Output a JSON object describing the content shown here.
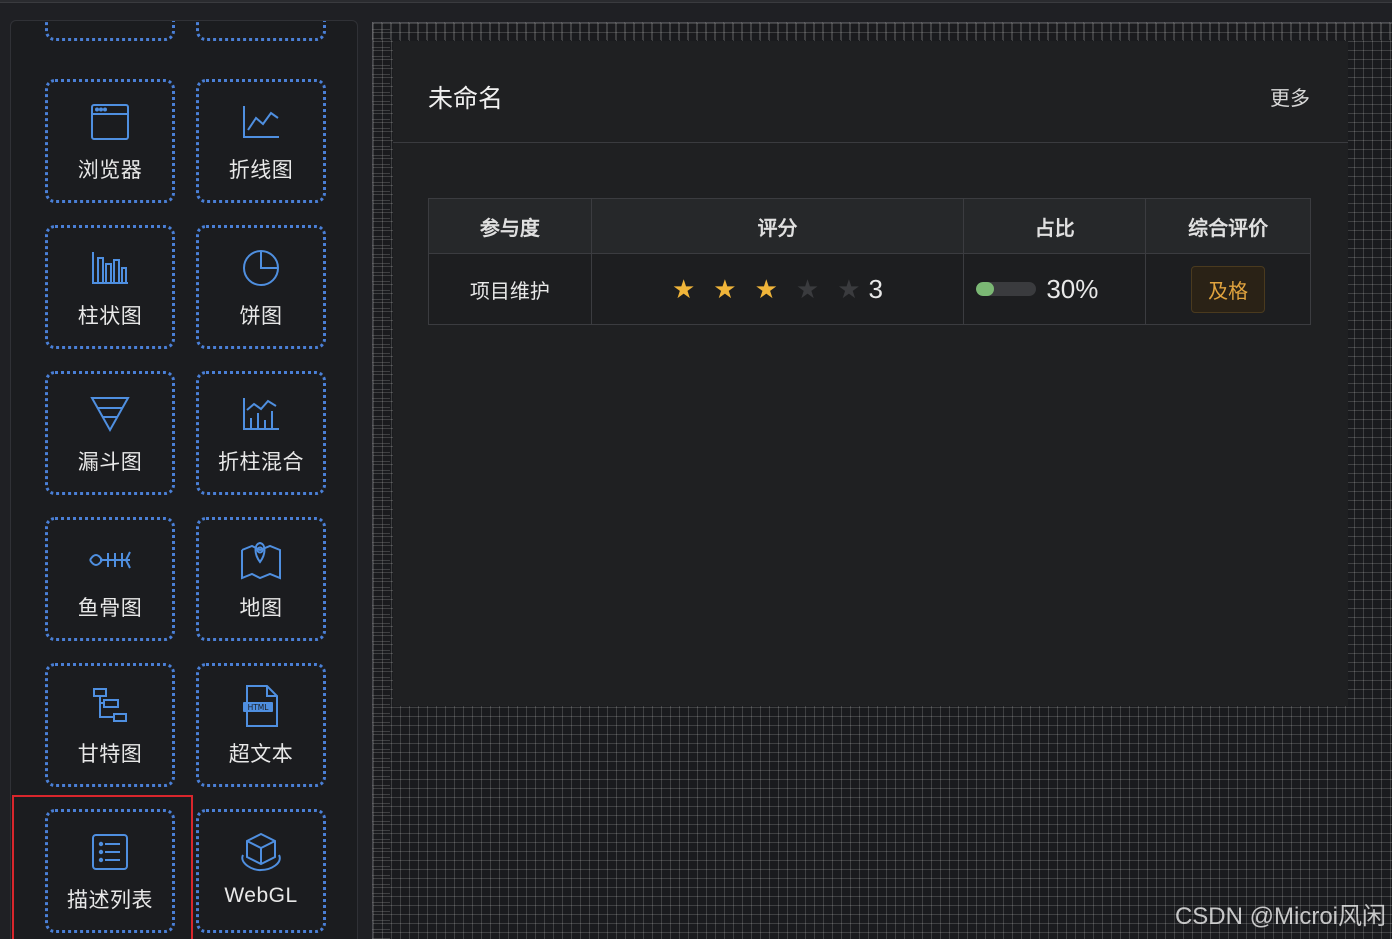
{
  "sidebar": {
    "items": [
      {
        "label": "浏览器",
        "icon": "browser-icon"
      },
      {
        "label": "折线图",
        "icon": "line-chart-icon"
      },
      {
        "label": "柱状图",
        "icon": "bar-chart-icon"
      },
      {
        "label": "饼图",
        "icon": "pie-chart-icon"
      },
      {
        "label": "漏斗图",
        "icon": "funnel-icon"
      },
      {
        "label": "折柱混合",
        "icon": "line-bar-mix-icon"
      },
      {
        "label": "鱼骨图",
        "icon": "fishbone-icon"
      },
      {
        "label": "地图",
        "icon": "map-icon"
      },
      {
        "label": "甘特图",
        "icon": "gantt-icon"
      },
      {
        "label": "超文本",
        "icon": "html-file-icon"
      },
      {
        "label": "描述列表",
        "icon": "description-list-icon"
      },
      {
        "label": "WebGL",
        "icon": "cube-3d-icon"
      }
    ]
  },
  "card": {
    "title": "未命名",
    "more": "更多",
    "table": {
      "headers": [
        "参与度",
        "评分",
        "占比",
        "综合评价"
      ],
      "row": {
        "name": "项目维护",
        "rating": 3,
        "rating_max": 5,
        "rating_text": "3",
        "percent": 0.3,
        "percent_text": "30%",
        "grade": "及格"
      }
    }
  },
  "watermark": "CSDN @Microi风闲",
  "colors": {
    "accent": "#4f8fe0",
    "star": "#f0b53a",
    "progress": "#7bb874",
    "tag": "#e0a33e",
    "highlight": "#d9262c"
  }
}
